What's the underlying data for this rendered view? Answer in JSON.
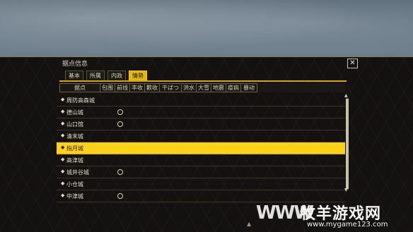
{
  "window": {
    "title": "据点信息",
    "close_glyph": "✕"
  },
  "tabs": [
    {
      "label": "基本",
      "active": false
    },
    {
      "label": "所属",
      "active": false
    },
    {
      "label": "内政",
      "active": false
    },
    {
      "label": "情勢",
      "active": true
    }
  ],
  "columns": [
    "据点",
    "包围",
    "前线",
    "丰收",
    "歉收",
    "干ばつ",
    "洪水",
    "大雪",
    "地震",
    "疫病",
    "暴动"
  ],
  "rows": [
    {
      "name": "周防高森城",
      "mark": false,
      "selected": false
    },
    {
      "name": "德山城",
      "mark": true,
      "selected": false
    },
    {
      "name": "山口馆",
      "mark": true,
      "selected": false
    },
    {
      "name": "清末城",
      "mark": false,
      "selected": false
    },
    {
      "name": "指月城",
      "mark": false,
      "selected": true
    },
    {
      "name": "高津城",
      "mark": false,
      "selected": false
    },
    {
      "name": "城井谷城",
      "mark": true,
      "selected": false
    },
    {
      "name": "小仓城",
      "mark": false,
      "selected": false
    },
    {
      "name": "中津城",
      "mark": true,
      "selected": false
    }
  ],
  "row_arrow": "◆",
  "watermark": {
    "name": "牧羊游戏网",
    "url": "www.mygame123.com",
    "logo": "WWW"
  },
  "colors": {
    "accent": "#e8b800",
    "selected_row": "#ffd21a",
    "panel_bg": "#141210"
  }
}
